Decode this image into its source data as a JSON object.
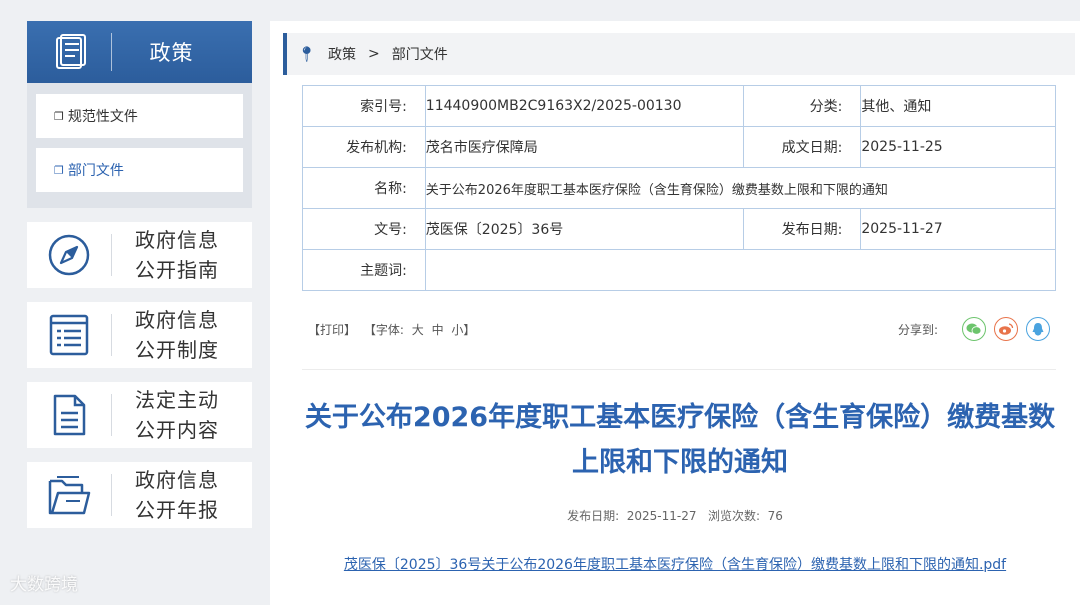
{
  "sidebar": {
    "header_title": "政策",
    "sub_items": [
      {
        "label": "规范性文件"
      },
      {
        "label": "部门文件"
      }
    ],
    "nav": [
      {
        "line1": "政府信息",
        "line2": "公开指南",
        "icon": "compass-icon"
      },
      {
        "line1": "政府信息",
        "line2": "公开制度",
        "icon": "list-icon"
      },
      {
        "line1": "法定主动",
        "line2": "公开内容",
        "icon": "document-icon"
      },
      {
        "line1": "政府信息",
        "line2": "公开年报",
        "icon": "folder-icon"
      }
    ]
  },
  "breadcrumb": {
    "level1": "政策",
    "separator": ">",
    "level2": "部门文件"
  },
  "meta": {
    "index_label": "索引号:",
    "index_value": "11440900MB2C9163X2/2025-00130",
    "category_label": "分类:",
    "category_value": "其他、通知",
    "org_label": "发布机构:",
    "org_value": "茂名市医疗保障局",
    "written_label": "成文日期:",
    "written_value": "2025-11-25",
    "name_label": "名称:",
    "name_value": "关于公布2026年度职工基本医疗保险（含生育保险）缴费基数上限和下限的通知",
    "docno_label": "文号:",
    "docno_value": "茂医保〔2025〕36号",
    "publish_label": "发布日期:",
    "publish_value": "2025-11-27",
    "subject_label": "主题词:",
    "subject_value": ""
  },
  "tools": {
    "print": "【打印】",
    "font": "【字体:",
    "large": "大",
    "medium": "中",
    "small": "小】"
  },
  "share": {
    "label": "分享到:"
  },
  "article": {
    "title": "关于公布2026年度职工基本医疗保险（含生育保险）缴费基数上限和下限的通知",
    "meta": "发布日期:  2025-11-27   浏览次数:  76",
    "attachment": "茂医保〔2025〕36号关于公布2026年度职工基本医疗保险（含生育保险）缴费基数上限和下限的通知.pdf"
  },
  "watermark": "大数跨境",
  "colors": {
    "accent": "#2c5d9c",
    "link": "#2c63b0"
  }
}
